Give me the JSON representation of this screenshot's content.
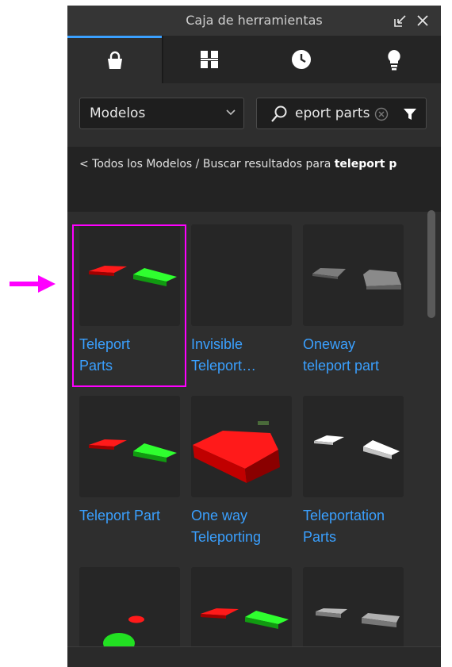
{
  "window": {
    "title": "Caja de herramientas",
    "undock_icon": "undock-icon",
    "close_icon": "close-icon"
  },
  "tabs": [
    {
      "name": "inventory",
      "icon": "shopping-bag-icon",
      "active": true
    },
    {
      "name": "marketplace",
      "icon": "grid-icon",
      "active": false
    },
    {
      "name": "recent",
      "icon": "clock-icon",
      "active": false
    },
    {
      "name": "creations",
      "icon": "lightbulb-icon",
      "active": false
    }
  ],
  "filter": {
    "category": "Modelos",
    "search_value": "teleport parts",
    "search_visible": "eport parts"
  },
  "breadcrumb": {
    "link": "< Todos los Modelos",
    "separator": " / ",
    "prefix": "Buscar resultados para ",
    "query": "teleport p"
  },
  "results": [
    {
      "name": "Teleport Parts",
      "line1": "Teleport",
      "line2": "Parts",
      "selected": true
    },
    {
      "name": "Invisible Teleport...",
      "line1": "Invisible",
      "line2": "Teleport…"
    },
    {
      "name": "Oneway teleport part",
      "line1": "Oneway",
      "line2": "teleport part"
    },
    {
      "name": "Teleport Part",
      "line1": "Teleport Part",
      "line2": ""
    },
    {
      "name": "One way Teleporting",
      "line1": "One way",
      "line2": "Teleporting"
    },
    {
      "name": "Teleportation Parts",
      "line1": "Teleportation",
      "line2": "Parts"
    }
  ],
  "colors": {
    "accent": "#3aa0ff",
    "highlight": "#ff00ff",
    "panel": "#2e2e2e"
  }
}
